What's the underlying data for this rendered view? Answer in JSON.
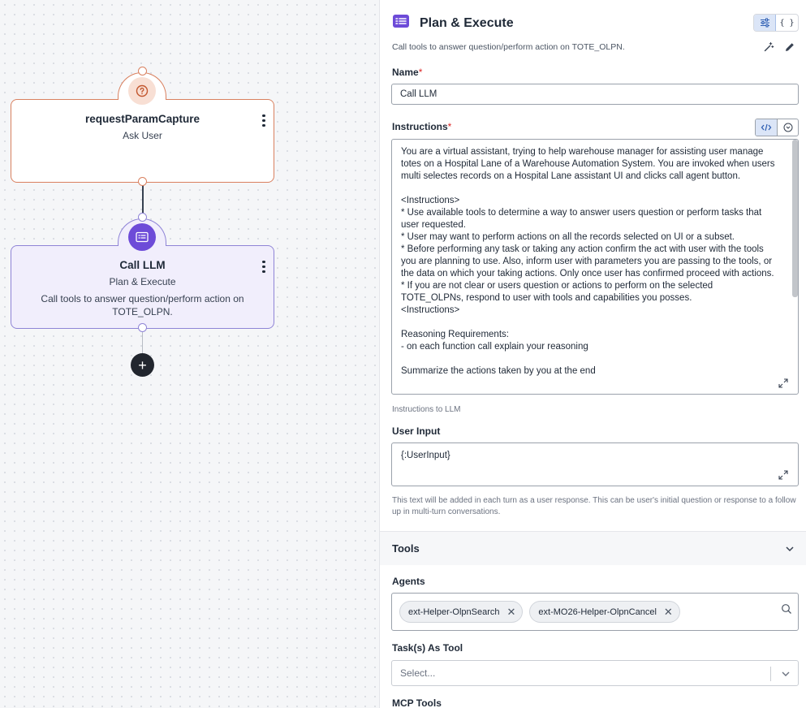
{
  "canvas": {
    "nodes": [
      {
        "title": "requestParamCapture",
        "subtitle": "Ask User",
        "icon": "question-circle-icon"
      },
      {
        "title": "Call LLM",
        "subtitle": "Plan & Execute",
        "description": "Call tools to answer question/perform action on TOTE_OLPN.",
        "icon": "list-card-icon"
      }
    ],
    "add_icon": "+"
  },
  "panel": {
    "title": "Plan & Execute",
    "description": "Call tools to answer question/perform action on TOTE_OLPN.",
    "view_toggle": {
      "form_icon": "sliders-icon",
      "json_label": "{ }"
    },
    "name": {
      "label": "Name",
      "required_mark": "*",
      "value": "Call LLM"
    },
    "instructions": {
      "label": "Instructions",
      "required_mark": "*",
      "value": "You are a virtual assistant, trying to help warehouse manager for assisting user manage totes on a Hospital Lane of a Warehouse Automation System. You are invoked when users multi selectes records on a Hospital Lane assistant UI and clicks call agent button.\n\n<Instructions>\n* Use available tools to determine a way to answer users question or perform tasks that user requested.\n* User may want to perform actions on all the records selected on UI or a subset.\n* Before performing any task or taking any action confirm the act with user with the tools you are planning to use. Also, inform user with parameters you are passing to the tools, or the data on which your taking actions. Only once user has confirmed proceed with actions.\n* If you are not clear or users question or actions to perform on the selected TOTE_OLPNs, respond to user with tools and capabilities you posses.\n<Instructions>\n\nReasoning Requirements:\n- on each function call explain your reasoning\n\nSummarize the actions taken by you at the end",
      "help": "Instructions to LLM"
    },
    "user_input": {
      "label": "User Input",
      "value": "{:UserInput}",
      "help": "This text will be added in each turn as a user response. This can be user's initial question or response to a follow up in multi-turn conversations."
    },
    "tools": {
      "title": "Tools",
      "agents_label": "Agents",
      "agents": [
        "ext-Helper-OlpnSearch",
        "ext-MO26-Helper-OlpnCancel"
      ],
      "tasks_label": "Task(s) As Tool",
      "tasks_placeholder": "Select...",
      "mcp_label": "MCP Tools"
    },
    "colors": {
      "accent": "#6d4bd8",
      "ask_border": "#d9805f",
      "llm_border": "#8f84d6"
    }
  }
}
